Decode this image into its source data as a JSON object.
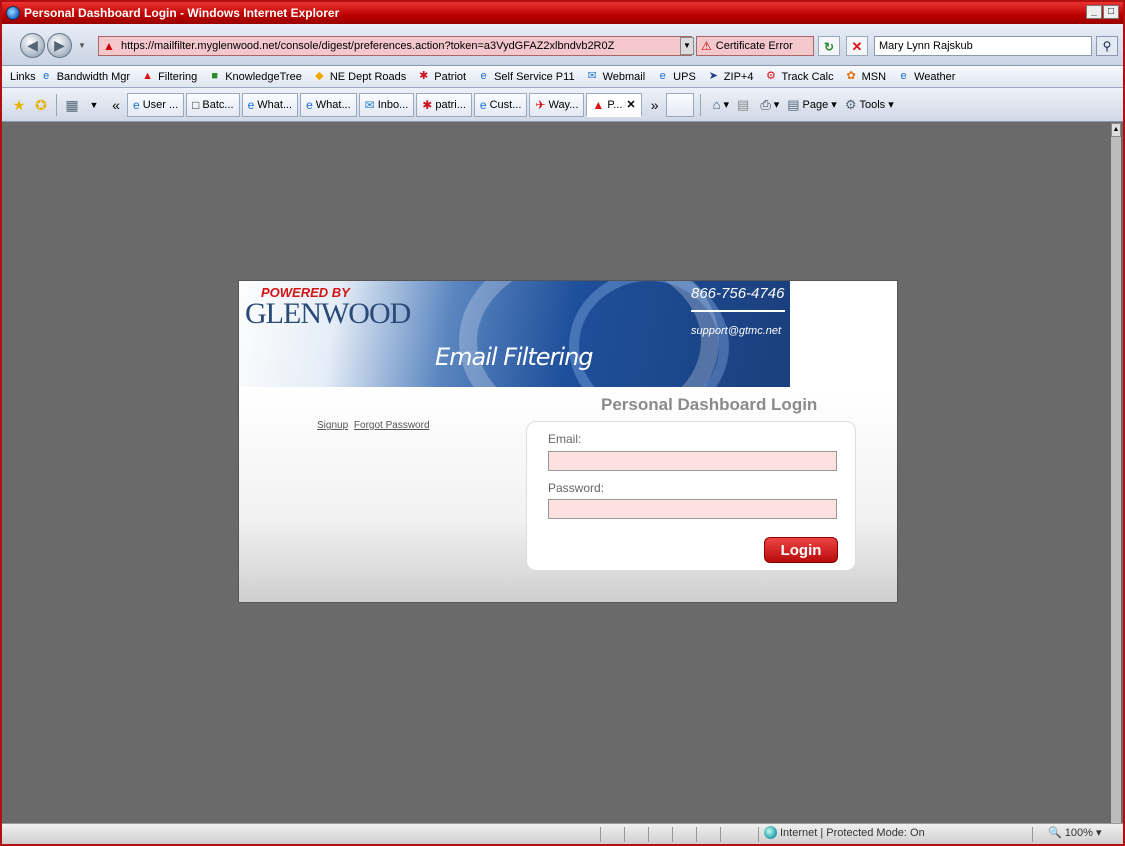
{
  "window": {
    "title": "Personal Dashboard Login - Windows Internet Explorer",
    "controls": [
      "_",
      "□"
    ]
  },
  "address": {
    "url": "https://mailfilter.myglenwood.net/console/digest/preferences.action?token=a3VydGFAZ2xlbndvb2R0Z",
    "cert_error": "Certificate Error",
    "search_value": "Mary Lynn Rajskub"
  },
  "links_bar": {
    "label": "Links",
    "items": [
      {
        "label": "Bandwidth Mgr",
        "icon": "ie-page-icon"
      },
      {
        "label": "Filtering",
        "icon": "red-arrow-icon"
      },
      {
        "label": "KnowledgeTree",
        "icon": "tree-icon"
      },
      {
        "label": "NE Dept Roads",
        "icon": "diamond-icon"
      },
      {
        "label": "Patriot",
        "icon": "patriot-icon"
      },
      {
        "label": "Self Service P11",
        "icon": "ie-page-icon"
      },
      {
        "label": "Webmail",
        "icon": "mail-icon"
      },
      {
        "label": "UPS",
        "icon": "ie-page-icon"
      },
      {
        "label": "ZIP+4",
        "icon": "zip-icon"
      },
      {
        "label": "Track Calc",
        "icon": "gear-icon"
      },
      {
        "label": "MSN",
        "icon": "butterfly-icon"
      },
      {
        "label": "Weather",
        "icon": "ie-page-icon"
      }
    ]
  },
  "tabs": [
    {
      "label": "User ...",
      "icon": "ie-page-icon"
    },
    {
      "label": "Batc...",
      "icon": "doc-icon"
    },
    {
      "label": "What...",
      "icon": "ie-page-icon"
    },
    {
      "label": "What...",
      "icon": "ie-page-icon"
    },
    {
      "label": "Inbo...",
      "icon": "mail-icon"
    },
    {
      "label": "patri...",
      "icon": "patriot-icon"
    },
    {
      "label": "Cust...",
      "icon": "ie-page-icon"
    },
    {
      "label": "Way...",
      "icon": "plane-icon"
    },
    {
      "label": "P...",
      "icon": "red-arrow-icon",
      "active": true
    }
  ],
  "commands": {
    "page": "Page",
    "tools": "Tools"
  },
  "banner": {
    "powered_by": "POWERED BY",
    "brand": "GLENWOOD",
    "product": "Email Filtering",
    "phone": "866-756-4746",
    "support": "support@gtmc.net"
  },
  "login": {
    "title": "Personal Dashboard Login",
    "signup": "Signup",
    "forgot": "Forgot Password",
    "email_label": "Email:",
    "password_label": "Password:",
    "email_value": "",
    "password_value": "",
    "button": "Login"
  },
  "status": {
    "zone": "Internet | Protected Mode: On",
    "zoom": "100%"
  },
  "colors": {
    "title_bar": "#b00000",
    "content_bg": "#6a6a6a",
    "login_button": "#d01818",
    "input_bg": "#fde0e0"
  }
}
